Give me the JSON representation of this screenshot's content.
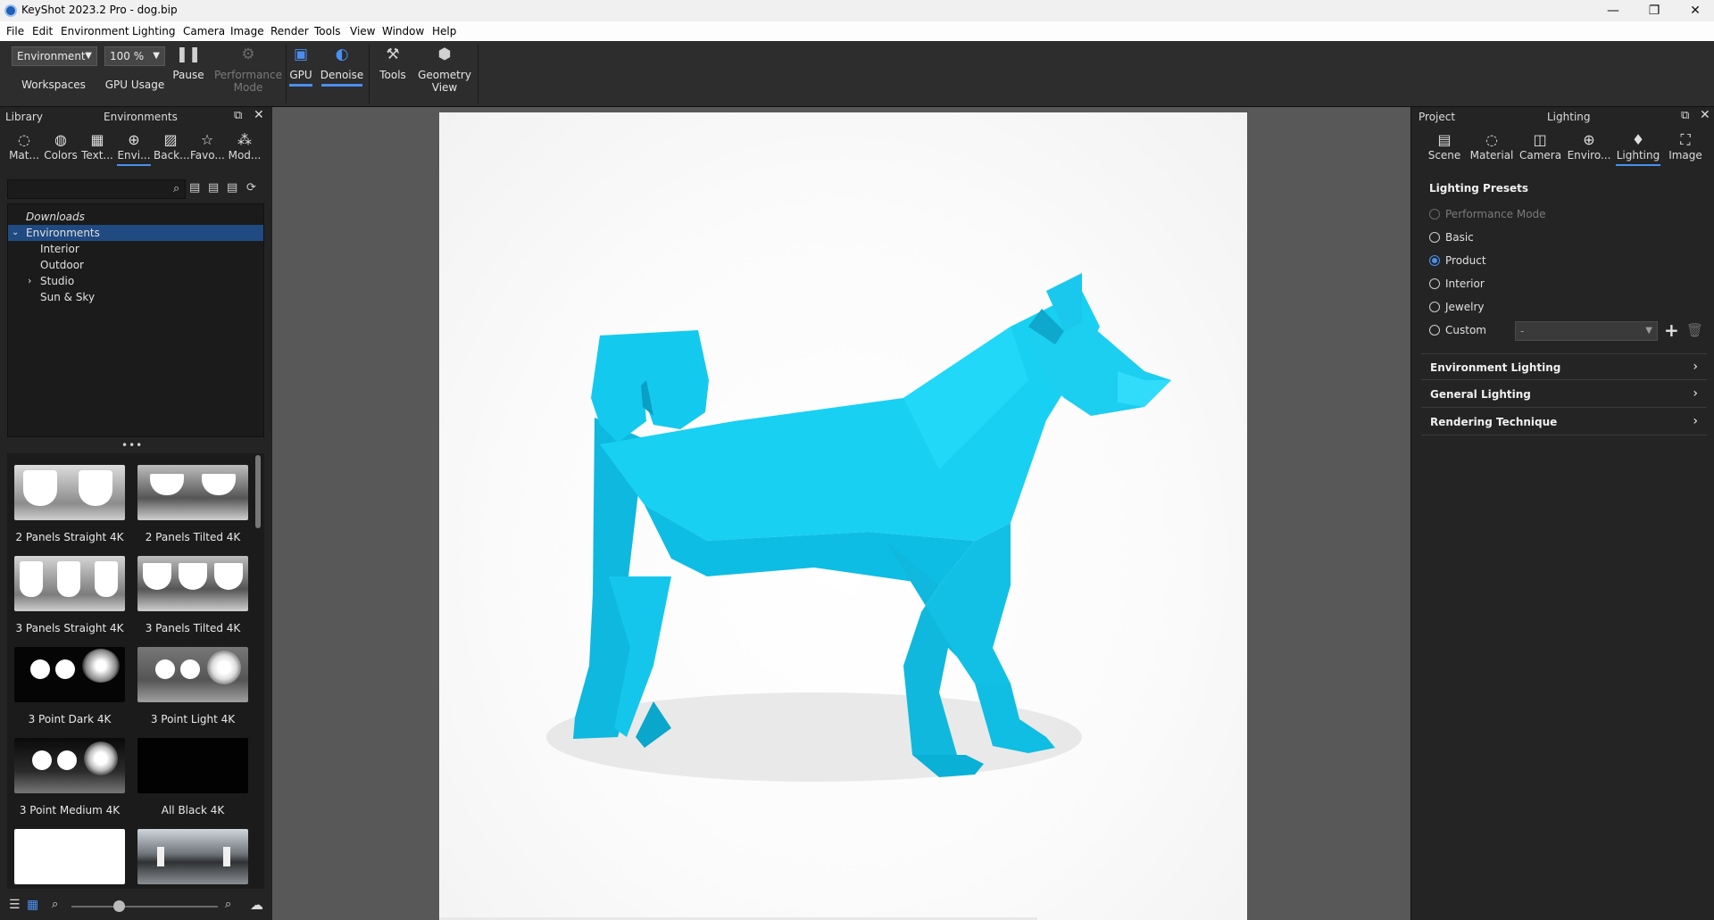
{
  "window": {
    "title": "KeyShot 2023.2 Pro  - dog.bip",
    "minimize": "—",
    "maximize": "❐",
    "close": "✕"
  },
  "menu": [
    "File",
    "Edit",
    "Environment",
    "Lighting",
    "Camera",
    "Image",
    "Render",
    "Tools",
    "View",
    "Window",
    "Help"
  ],
  "toolbar": {
    "workspace_value": "Environment",
    "workspaces_label": "Workspaces",
    "zoom_value": "100 %",
    "gpu_usage_label": "GPU Usage",
    "pause_label": "Pause",
    "performance_mode_label": "Performance Mode",
    "gpu_label": "GPU",
    "denoise_label": "Denoise",
    "tools_label": "Tools",
    "geometry_view_label": "Geometry View"
  },
  "library": {
    "header_left": "Library",
    "header_title": "Environments",
    "tabs": [
      {
        "label": "Mat...",
        "icon": "material-icon"
      },
      {
        "label": "Colors",
        "icon": "palette-icon"
      },
      {
        "label": "Text...",
        "icon": "texture-icon"
      },
      {
        "label": "Envi...",
        "icon": "globe-icon"
      },
      {
        "label": "Back...",
        "icon": "image-icon"
      },
      {
        "label": "Favo...",
        "icon": "star-icon"
      },
      {
        "label": "Mod...",
        "icon": "models-icon"
      }
    ],
    "search_placeholder": "",
    "tree": [
      "Downloads",
      "Environments",
      "Interior",
      "Outdoor",
      "Studio",
      "Sun & Sky"
    ],
    "more": "•••",
    "thumbnails": [
      "2 Panels Straight 4K",
      "2 Panels Tilted 4K",
      "3 Panels Straight 4K",
      "3 Panels Tilted 4K",
      "3 Point Dark 4K",
      "3 Point Light 4K",
      "3 Point Medium 4K",
      "All Black 4K"
    ]
  },
  "right_panel": {
    "header_left": "Project",
    "header_title": "Lighting",
    "tabs": [
      {
        "label": "Scene",
        "icon": "scene-icon"
      },
      {
        "label": "Material",
        "icon": "material-icon"
      },
      {
        "label": "Camera",
        "icon": "camera-icon"
      },
      {
        "label": "Enviro...",
        "icon": "globe-icon"
      },
      {
        "label": "Lighting",
        "icon": "bulb-icon"
      },
      {
        "label": "Image",
        "icon": "crop-icon"
      }
    ],
    "presets_title": "Lighting Presets",
    "presets": [
      "Performance Mode",
      "Basic",
      "Product",
      "Interior",
      "Jewelry",
      "Custom"
    ],
    "selected_preset": "Product",
    "custom_value": "-",
    "sections": [
      "Environment Lighting",
      "General Lighting",
      "Rendering Technique"
    ]
  },
  "colors": {
    "accent": "#4a8ff0",
    "dog": "#14c9ee"
  }
}
